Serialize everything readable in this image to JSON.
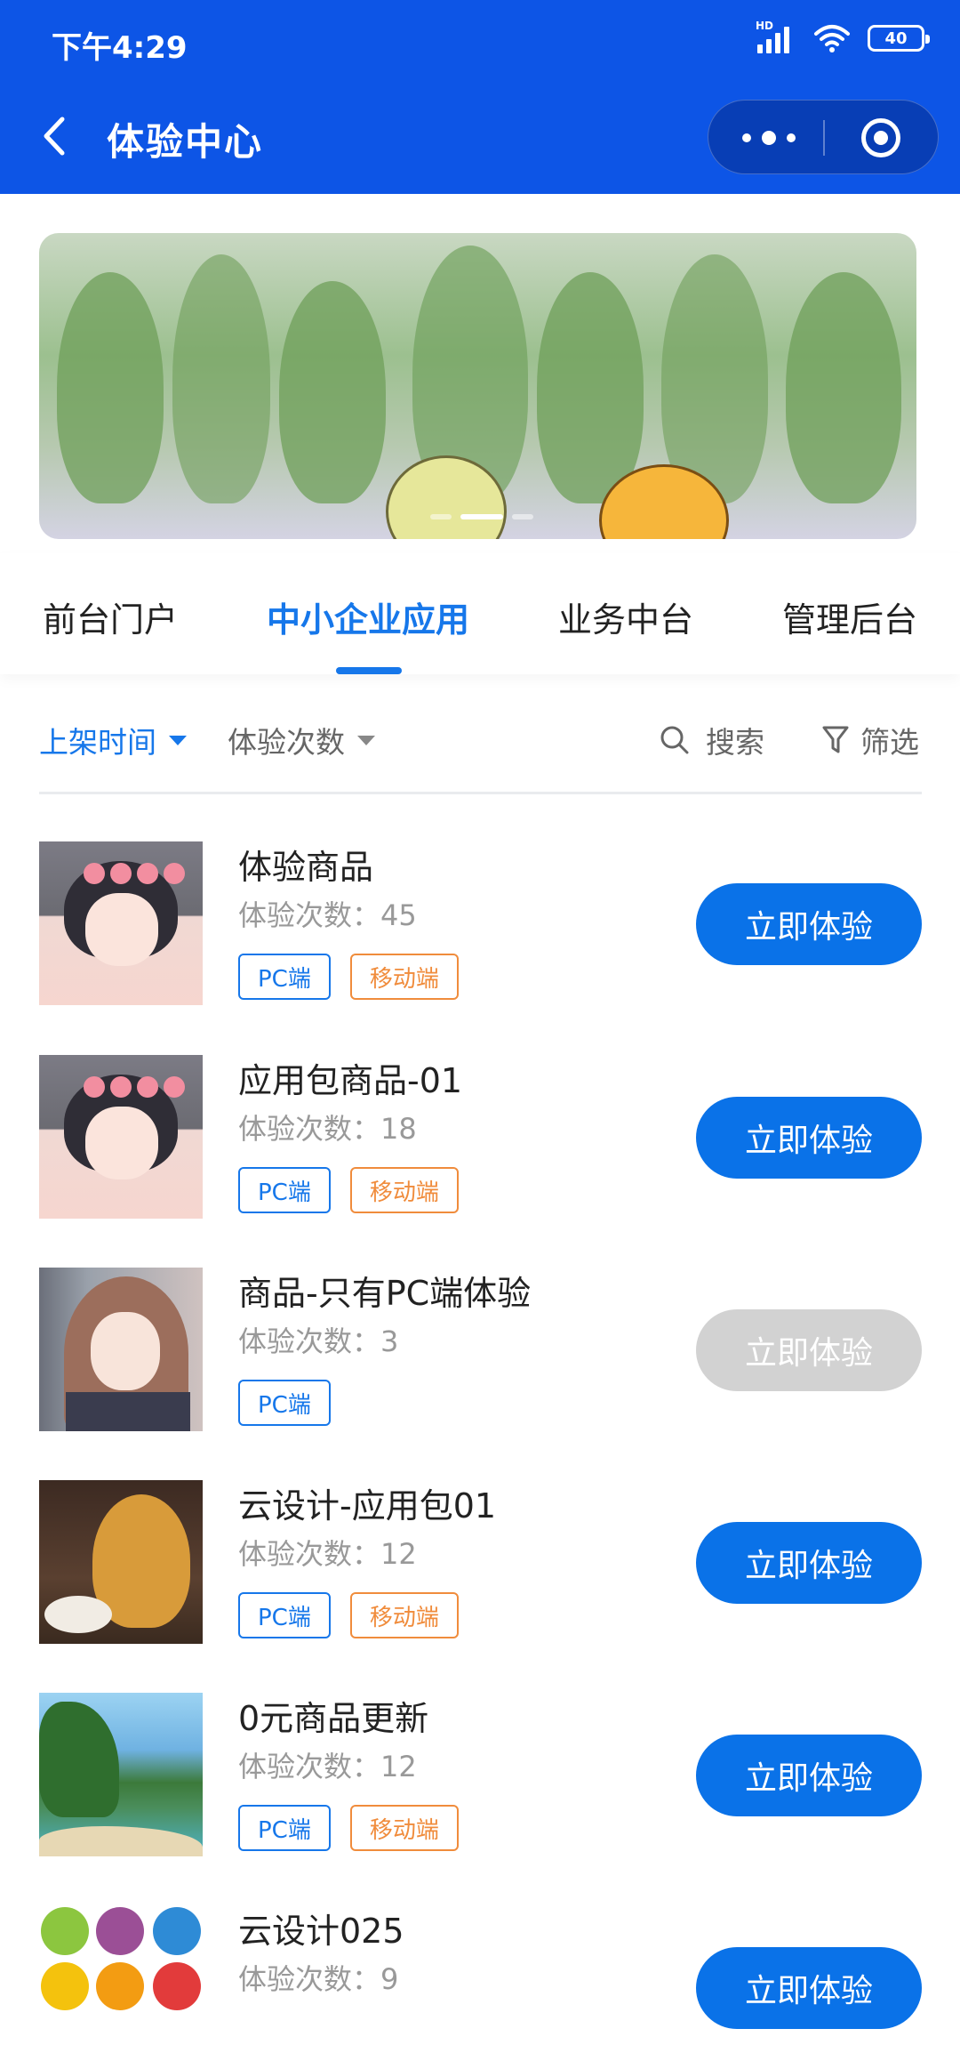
{
  "status_bar": {
    "time": "下午4:29",
    "network_label": "HD",
    "battery": "40"
  },
  "nav": {
    "title": "体验中心",
    "back_icon": "chevron-left-icon",
    "menu_icon": "more-dots-icon",
    "close_icon": "target-circle-icon"
  },
  "banner": {
    "slide_count": 3,
    "active_slide": 2
  },
  "tabs": [
    {
      "label": "前台门户",
      "active": false
    },
    {
      "label": "中小企业应用",
      "active": true
    },
    {
      "label": "业务中台",
      "active": false
    },
    {
      "label": "管理后台",
      "active": false
    }
  ],
  "filters": {
    "sort_time": "上架时间",
    "sort_count": "体验次数",
    "search": "搜索",
    "filter": "筛选"
  },
  "colors": {
    "brand": "#0d55e6",
    "accent": "#1677ea",
    "button": "#0a72e8",
    "button_disabled": "#d2d2d2",
    "tag_pc": "#1677ea",
    "tag_mobile": "#f08c3c"
  },
  "products": [
    {
      "name": "体验商品",
      "count": "体验次数：45",
      "tags": [
        "PC端",
        "移动端"
      ],
      "button": "立即体验",
      "enabled": true
    },
    {
      "name": "应用包商品-01",
      "count": "体验次数：18",
      "tags": [
        "PC端",
        "移动端"
      ],
      "button": "立即体验",
      "enabled": true
    },
    {
      "name": "商品-只有PC端体验",
      "count": "体验次数：3",
      "tags": [
        "PC端"
      ],
      "button": "立即体验",
      "enabled": false
    },
    {
      "name": "云设计-应用包01",
      "count": "体验次数：12",
      "tags": [
        "PC端",
        "移动端"
      ],
      "button": "立即体验",
      "enabled": true
    },
    {
      "name": "0元商品更新",
      "count": "体验次数：12",
      "tags": [
        "PC端",
        "移动端"
      ],
      "button": "立即体验",
      "enabled": true
    },
    {
      "name": "云设计025",
      "count": "体验次数：9",
      "tags": [],
      "button": "立即体验",
      "enabled": true
    }
  ]
}
